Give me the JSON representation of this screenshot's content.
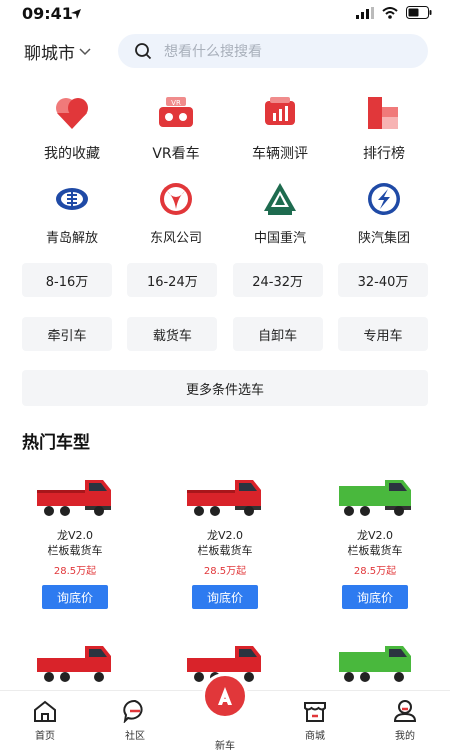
{
  "status": {
    "time": "09:41"
  },
  "header": {
    "city": "聊城市",
    "search_placeholder": "想看什么搜搜看"
  },
  "quick": [
    {
      "label": "我的收藏",
      "icon": "heart-icon"
    },
    {
      "label": "VR看车",
      "icon": "vr-headset-icon"
    },
    {
      "label": "车辆测评",
      "icon": "evaluation-icon"
    },
    {
      "label": "排行榜",
      "icon": "ranking-icon"
    }
  ],
  "brands": [
    {
      "label": "青岛解放",
      "icon": "faw-logo-icon"
    },
    {
      "label": "东风公司",
      "icon": "dongfeng-logo-icon"
    },
    {
      "label": "中国重汽",
      "icon": "sinotruk-logo-icon"
    },
    {
      "label": "陕汽集团",
      "icon": "shacman-logo-icon"
    }
  ],
  "price_ranges": [
    "8-16万",
    "16-24万",
    "24-32万",
    "32-40万"
  ],
  "vehicle_types": [
    "牵引车",
    "载货车",
    "自卸车",
    "专用车"
  ],
  "more_filters": "更多条件选车",
  "hot": {
    "title": "热门车型",
    "cards": [
      {
        "name": "龙V2.0\n栏板载货车",
        "price": "28.5万起",
        "button": "询底价",
        "color": "#d9232a"
      },
      {
        "name": "龙V2.0\n栏板载货车",
        "price": "28.5万起",
        "button": "询底价",
        "color": "#d9232a"
      },
      {
        "name": "龙V2.0\n栏板载货车",
        "price": "28.5万起",
        "button": "询底价",
        "color": "#49b83d"
      }
    ],
    "cards_row2": [
      {
        "color": "#d9232a"
      },
      {
        "color": "#d9232a"
      },
      {
        "color": "#49b83d"
      }
    ]
  },
  "tabbar": [
    {
      "label": "首页",
      "icon": "home-icon"
    },
    {
      "label": "社区",
      "icon": "community-icon"
    },
    {
      "label": "新车",
      "icon": "new-car-icon"
    },
    {
      "label": "商城",
      "icon": "shop-icon"
    },
    {
      "label": "我的",
      "icon": "profile-icon"
    }
  ],
  "colors": {
    "accent": "#e1373a",
    "button_blue": "#2e7bf0",
    "chip_bg": "#f4f5f7"
  }
}
